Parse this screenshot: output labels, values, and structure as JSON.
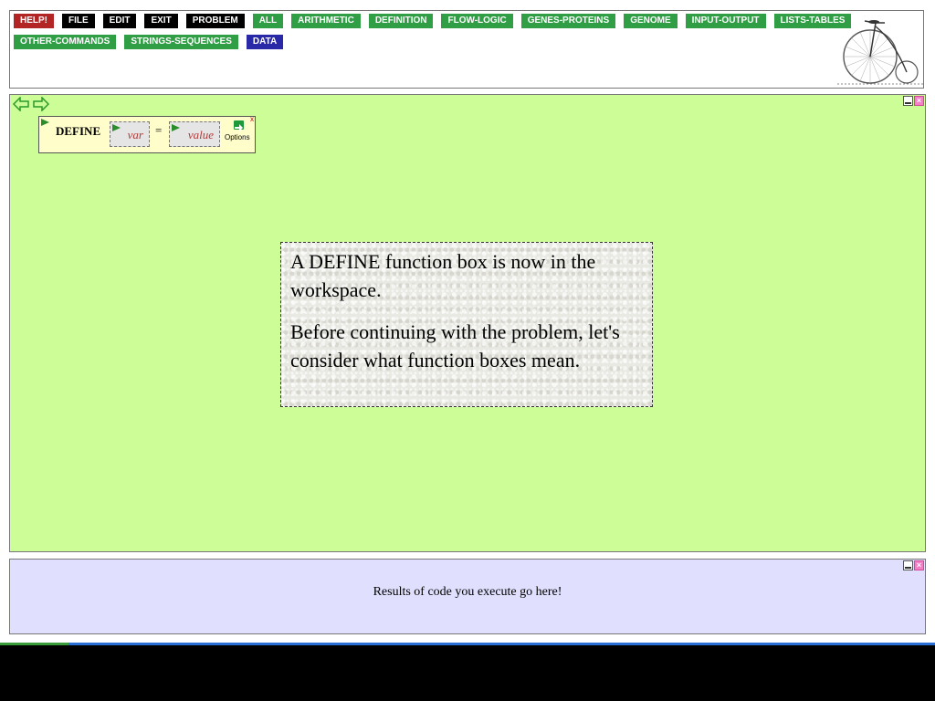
{
  "menu": {
    "row1": [
      {
        "label": "HELP!",
        "color": "red"
      },
      {
        "label": "FILE",
        "color": "black"
      },
      {
        "label": "EDIT",
        "color": "black"
      },
      {
        "label": "EXIT",
        "color": "black"
      },
      {
        "label": "PROBLEM",
        "color": "black"
      },
      {
        "label": "ALL",
        "color": "green"
      },
      {
        "label": "ARITHMETIC",
        "color": "green"
      },
      {
        "label": "DEFINITION",
        "color": "green"
      },
      {
        "label": "FLOW-LOGIC",
        "color": "green"
      },
      {
        "label": "GENES-PROTEINS",
        "color": "green"
      },
      {
        "label": "GENOME",
        "color": "green"
      },
      {
        "label": "INPUT-OUTPUT",
        "color": "green"
      },
      {
        "label": "LISTS-TABLES",
        "color": "green"
      }
    ],
    "row2": [
      {
        "label": "OTHER-COMMANDS",
        "color": "green"
      },
      {
        "label": "STRINGS-SEQUENCES",
        "color": "green"
      },
      {
        "label": "DATA",
        "color": "blue"
      }
    ],
    "logo_icon": "penny-farthing-bicycle-icon"
  },
  "workspace": {
    "background": "#cdfd97",
    "define_box": {
      "label": "DEFINE",
      "var_placeholder": "var",
      "equals": "=",
      "value_placeholder": "value",
      "options_label": "Options",
      "close_glyph": "x"
    },
    "message": {
      "paragraph1": "A DEFINE function box is now in the workspace.",
      "paragraph2": "Before continuing with the problem, let's consider what function boxes mean."
    }
  },
  "results": {
    "text": "Results of code you execute go here!",
    "background": "#e0e0fe"
  },
  "colors": {
    "help_red": "#b32525",
    "menu_black": "#000000",
    "menu_green": "#2f9e45",
    "data_blue": "#2929a8"
  }
}
